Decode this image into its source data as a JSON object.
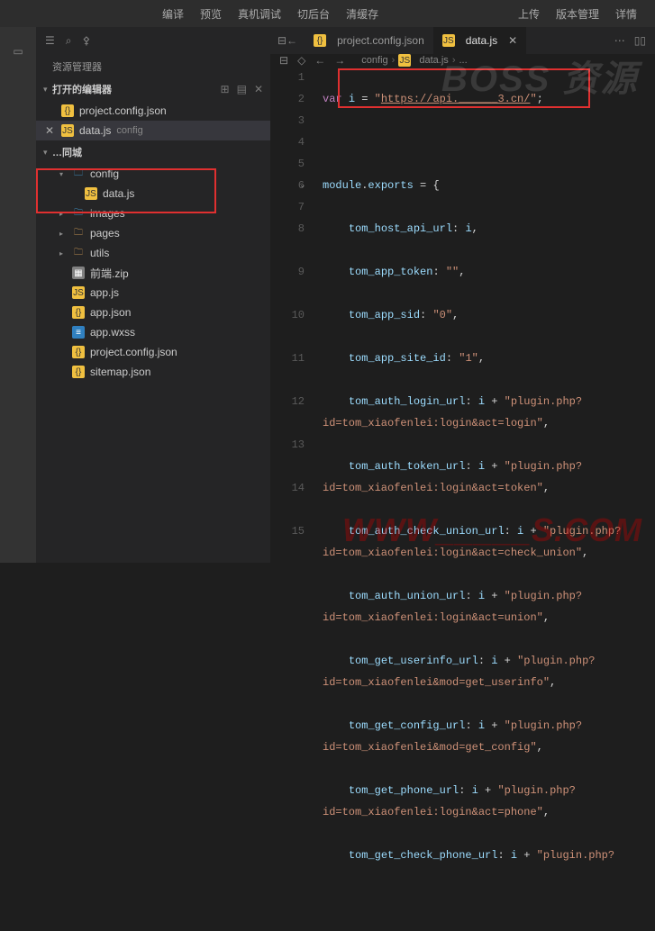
{
  "topbar": {
    "left": [
      "编译",
      "预览",
      "真机调试",
      "切后台",
      "清缓存"
    ],
    "right": [
      "上传",
      "版本管理",
      "详情"
    ]
  },
  "sidebar": {
    "explorer_title": "资源管理器",
    "open_editors_label": "打开的编辑器",
    "open_editors": [
      {
        "name": "project.config.json",
        "icon": "json"
      },
      {
        "name": "data.js",
        "dim": "config",
        "icon": "js",
        "selected": true
      }
    ],
    "project_label": "…同城",
    "tree": [
      {
        "name": "config",
        "icon": "folder-blue",
        "chev": "▾",
        "children": [
          {
            "name": "data.js",
            "icon": "js"
          }
        ]
      },
      {
        "name": "images",
        "icon": "folder-blue",
        "chev": "▸"
      },
      {
        "name": "pages",
        "icon": "folder",
        "chev": "▸"
      },
      {
        "name": "utils",
        "icon": "folder",
        "chev": "▸"
      },
      {
        "name": "前端.zip",
        "icon": "zip"
      },
      {
        "name": "app.js",
        "icon": "js"
      },
      {
        "name": "app.json",
        "icon": "json"
      },
      {
        "name": "app.wxss",
        "icon": "wxss"
      },
      {
        "name": "project.config.json",
        "icon": "json"
      },
      {
        "name": "sitemap.json",
        "icon": "json"
      }
    ]
  },
  "tabs": [
    {
      "name": "project.config.json",
      "icon": "json"
    },
    {
      "name": "data.js",
      "icon": "js",
      "active": true
    }
  ],
  "breadcrumb": {
    "parts": [
      "config",
      "data.js",
      "..."
    ]
  },
  "code": {
    "url_value": "https://api.______3.cn/",
    "lines": {
      "l1_var": "var",
      "l1_i": "i",
      "l1_eq": "=",
      "l3": "module.exports = {",
      "p4": "tom_host_api_url",
      "v4": "i",
      "p5": "tom_app_token",
      "v5": "\"\"",
      "p6": "tom_app_sid",
      "v6": "\"0\"",
      "p7": "tom_app_site_id",
      "v7": "\"1\"",
      "p8": "tom_auth_login_url",
      "s8": "\"plugin.php?id=tom_xiaofenlei:login&act=login\"",
      "p9": "tom_auth_token_url",
      "s9": "\"plugin.php?id=tom_xiaofenlei:login&act=token\"",
      "p10": "tom_auth_check_union_url",
      "s10": "\"plugin.php?id=tom_xiaofenlei:login&act=check_union\"",
      "p11": "tom_auth_union_url",
      "s11": "\"plugin.php?id=tom_xiaofenlei:login&act=union\"",
      "p12": "tom_get_userinfo_url",
      "s12": "\"plugin.php?id=tom_xiaofenlei&mod=get_userinfo\"",
      "p13": "tom_get_config_url",
      "s13": "\"plugin.php?id=tom_xiaofenlei&mod=get_config\"",
      "p14": "tom_get_phone_url",
      "s14": "\"plugin.php?id=tom_xiaofenlei:login&act=phone\"",
      "p15": "tom_get_check_phone_url",
      "s15": "\"plugin.php?"
    }
  },
  "watermark1": "BOSS 资源",
  "watermark2": "WWW_____S.COM"
}
